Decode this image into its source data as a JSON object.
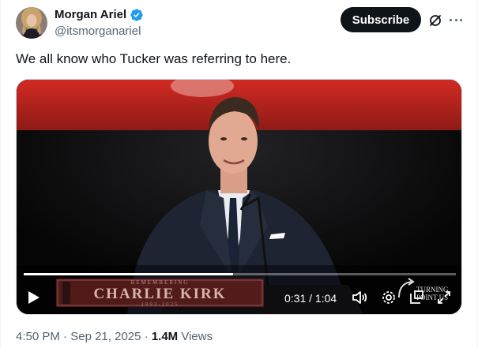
{
  "author": {
    "display_name": "Morgan Ariel",
    "handle": "@itsmorganariel",
    "verified": true
  },
  "actions": {
    "subscribe_label": "Subscribe"
  },
  "tweet": {
    "text": "We all know who Tucker was referring to here."
  },
  "video": {
    "current_time": "0:31",
    "duration": "1:04",
    "time_display": "0:31 / 1:04",
    "progress": 0.484,
    "overlay": {
      "remembering": "REMEMBERING",
      "name": "CHARLIE KIRK",
      "years": "1993-2025"
    },
    "watermark": "TURNING POINT USA"
  },
  "meta": {
    "time": "4:50 PM",
    "separator": "·",
    "date": "Sep 21, 2025",
    "views_count": "1.4M",
    "views_label": "Views"
  },
  "colors": {
    "text": "#0f1419",
    "secondary": "#536471",
    "verified": "#1d9bf0",
    "button_bg": "#0f1419",
    "stage_red": "#c2241f"
  },
  "icons": [
    "grok-icon",
    "more-icon",
    "verified-icon",
    "play-icon",
    "volume-icon",
    "settings-icon",
    "pip-icon",
    "fullscreen-icon"
  ]
}
